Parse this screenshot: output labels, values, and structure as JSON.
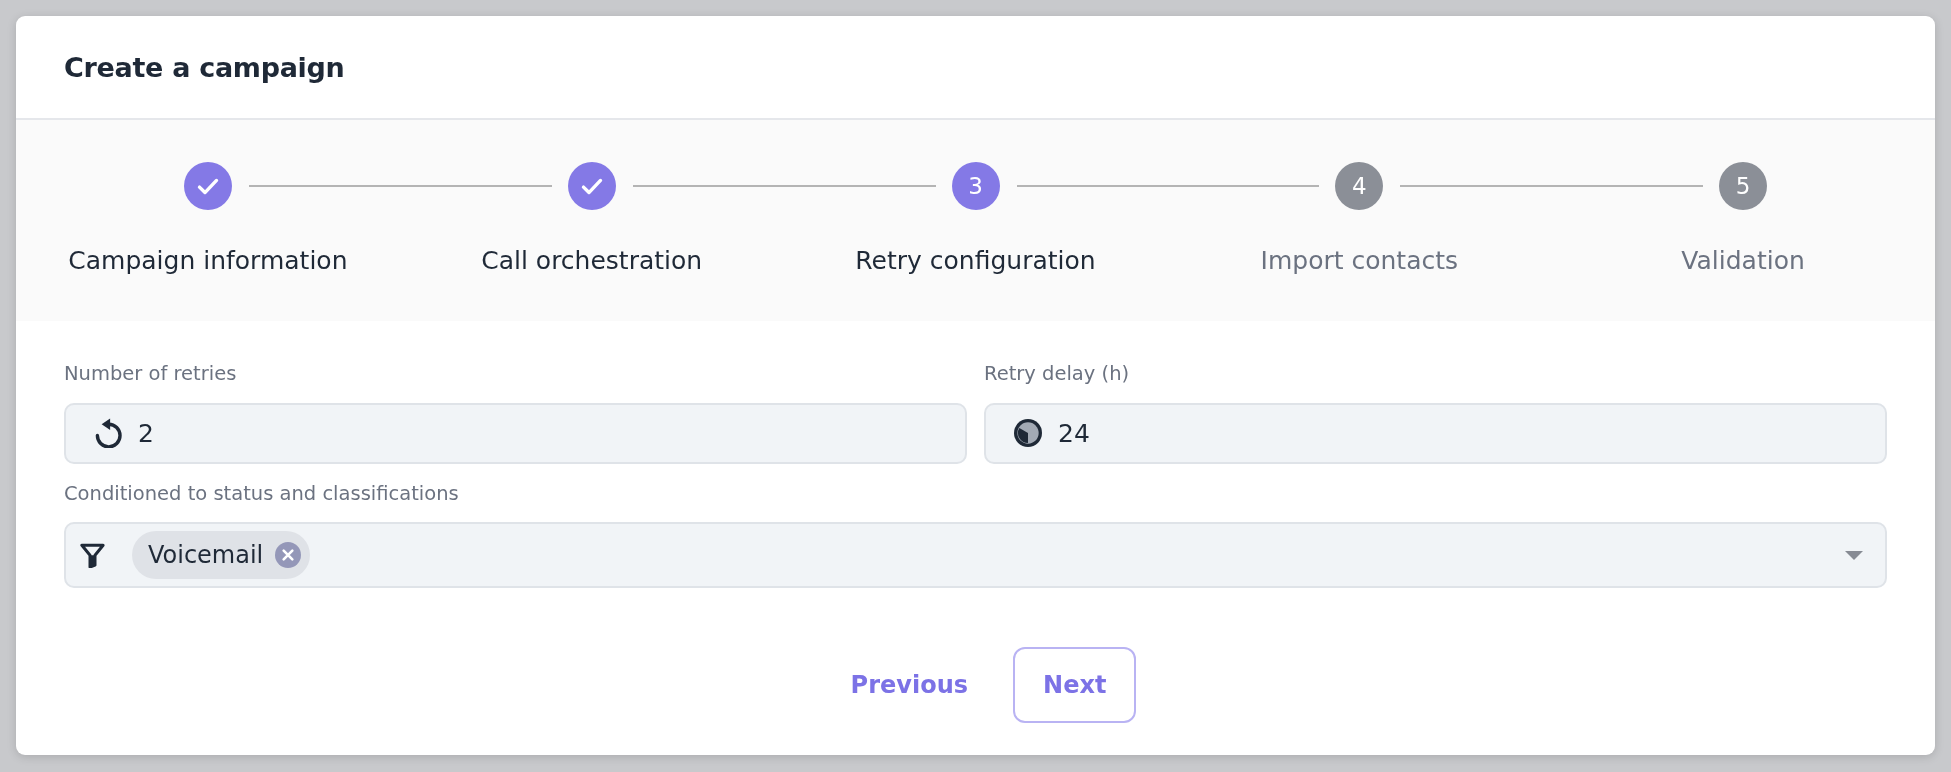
{
  "dialog": {
    "title": "Create a campaign"
  },
  "steps": [
    {
      "label": "Campaign information",
      "completed": true,
      "selected": false
    },
    {
      "label": "Call orchestration",
      "completed": true,
      "selected": false
    },
    {
      "label": "Retry configuration",
      "number": "3",
      "completed": false,
      "selected": true
    },
    {
      "label": "Import contacts",
      "number": "4",
      "completed": false,
      "selected": false
    },
    {
      "label": "Validation",
      "number": "5",
      "completed": false,
      "selected": false
    }
  ],
  "fields": [
    {
      "label": "Number of retries",
      "value": "2"
    },
    {
      "label": "Retry delay (h)",
      "value": "24"
    }
  ],
  "filter": {
    "label": "Conditioned to status and classifications",
    "tags": [
      {
        "label": "Voicemail"
      }
    ]
  },
  "buttons": [
    {
      "label": "Previous",
      "kind": "text"
    },
    {
      "label": "Next",
      "kind": "outlined"
    }
  ]
}
